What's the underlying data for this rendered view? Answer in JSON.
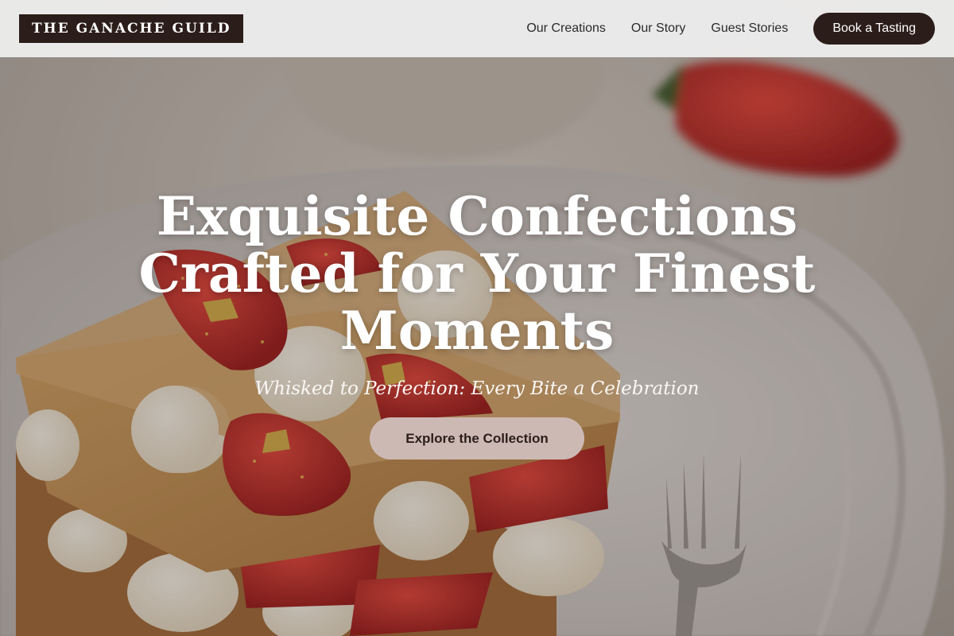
{
  "brand": {
    "name": "THE GANACHE GUILD"
  },
  "nav": {
    "links": [
      "Our Creations",
      "Our Story",
      "Guest Stories"
    ],
    "cta_label": "Book a Tasting"
  },
  "hero": {
    "headline": "Exquisite Confections Crafted for Your Finest Moments",
    "tagline": "Whisked to Perfection: Every Bite a Celebration",
    "cta_label": "Explore the Collection",
    "background_image": "strawberry-mille-feuille-photo"
  },
  "colors": {
    "brand_dark": "#2b1d1a",
    "nav_background": "#f0f0f0",
    "hero_cta_background": "#cdb9b4"
  }
}
